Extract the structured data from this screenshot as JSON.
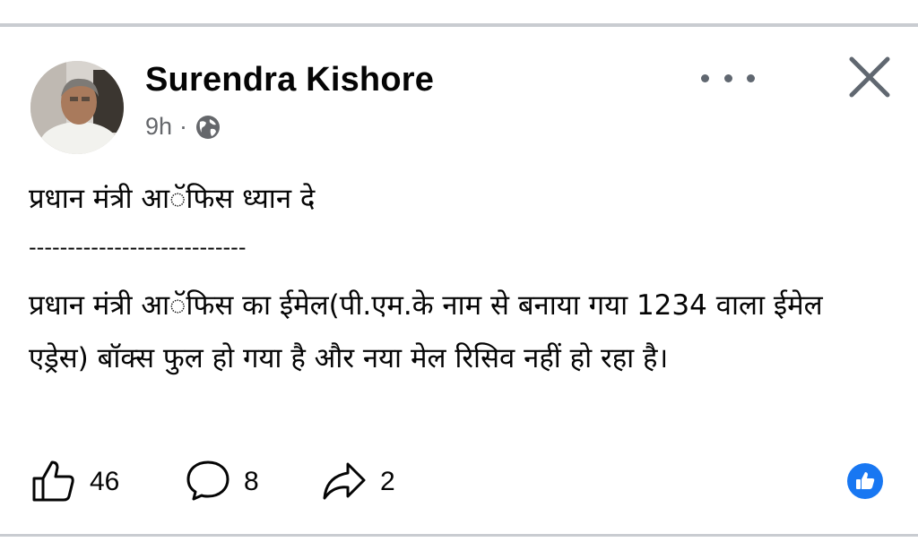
{
  "post": {
    "author": "Surendra Kishore",
    "time": "9h",
    "separator_dot": "·",
    "privacy_icon": "globe-icon",
    "line1": "प्रधान मंत्री आॅफिस ध्यान दे",
    "separator": "----------------------------",
    "paragraph": "प्रधान मंत्री आॅफिस का ईमेल(पी.एम.के नाम से बनाया गया 1234 वाला ईमेल एड्रेस) बॉक्स फुल हो गया है और नया मेल रिसिव नहीं हो रहा है।"
  },
  "actions": {
    "likes": "46",
    "comments": "8",
    "shares": "2"
  },
  "colors": {
    "text": "#050505",
    "muted": "#65676b",
    "reaction_blue": "#1877f2",
    "divider": "#c9ccd1"
  }
}
